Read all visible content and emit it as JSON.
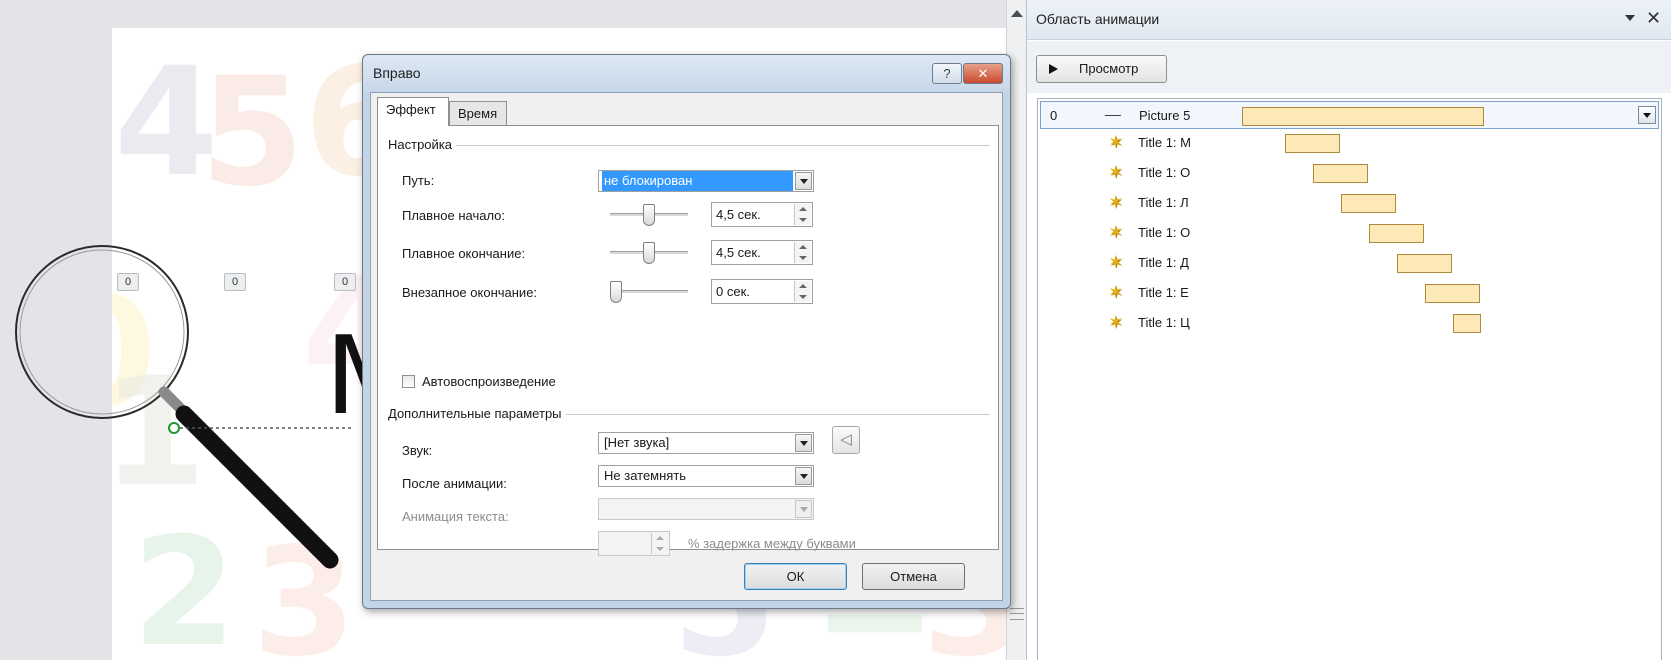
{
  "slide": {
    "timing_markers": [
      "0",
      "0",
      "0"
    ],
    "title_text": "МО"
  },
  "dialog": {
    "title": "Вправо",
    "help_label": "?",
    "close_label": "✕",
    "tabs": [
      {
        "label": "Эффект",
        "selected": true
      },
      {
        "label": "Время",
        "selected": false
      }
    ],
    "settings": {
      "group_title": "Настройка",
      "path": {
        "label": "Путь:",
        "value": "не блокирован"
      },
      "smooth_start": {
        "label": "Плавное начало:",
        "value": "4,5 сек.",
        "slider_fraction": 0.5
      },
      "smooth_end": {
        "label": "Плавное окончание:",
        "value": "4,5 сек.",
        "slider_fraction": 0.5
      },
      "bounce_end": {
        "label": "Внезапное окончание:",
        "value": "0 сек.",
        "slider_fraction": 0.0
      },
      "autoreverse": {
        "label": "Автовоспроизведение",
        "checked": false
      }
    },
    "enhancements": {
      "group_title": "Дополнительные параметры",
      "sound": {
        "label": "Звук:",
        "value": "[Нет звука]"
      },
      "after_animation": {
        "label": "После анимации:",
        "value": "Не затемнять"
      },
      "animate_text": {
        "label": "Анимация текста:",
        "value": ""
      },
      "delay_label": "% задержка между буквами"
    },
    "ok_label": "ОК",
    "cancel_label": "Отмена"
  },
  "pane": {
    "title": "Область анимации",
    "play_label": "Просмотр",
    "close_label": "✕",
    "items": [
      {
        "step": "0",
        "name": "Picture 5",
        "icon": "line-icon",
        "selected": true
      },
      {
        "step": "",
        "name": "Title 1: М",
        "icon": "star-effect-icon",
        "selected": false
      },
      {
        "step": "",
        "name": "Title 1: О",
        "icon": "star-effect-icon",
        "selected": false
      },
      {
        "step": "",
        "name": "Title 1: Л",
        "icon": "star-effect-icon",
        "selected": false
      },
      {
        "step": "",
        "name": "Title 1: О",
        "icon": "star-effect-icon",
        "selected": false
      },
      {
        "step": "",
        "name": "Title 1: Д",
        "icon": "star-effect-icon",
        "selected": false
      },
      {
        "step": "",
        "name": "Title 1: Е",
        "icon": "star-effect-icon",
        "selected": false
      },
      {
        "step": "",
        "name": "Title 1: Ц",
        "icon": "star-effect-icon",
        "selected": false
      }
    ]
  },
  "colors": {
    "selection": "#3399ff",
    "timeline_bar": "#fde8b8",
    "dialog_frame": "#c3d4e7",
    "close_button": "#c84a2e"
  }
}
